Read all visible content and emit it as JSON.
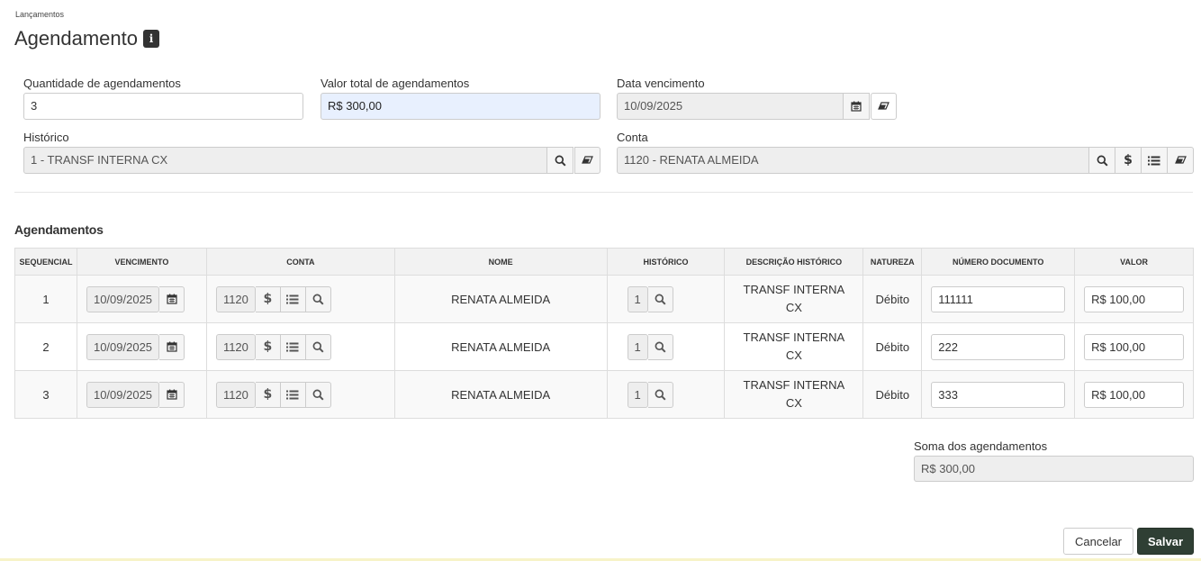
{
  "breadcrumb": "Lançamentos",
  "page_title": "Agendamento",
  "info_glyph": "i",
  "form": {
    "quantidade": {
      "label": "Quantidade de agendamentos",
      "value": "3"
    },
    "valor_total": {
      "label": "Valor total de agendamentos",
      "value": "R$ 300,00"
    },
    "data_vencimento": {
      "label": "Data vencimento",
      "value": "10/09/2025"
    },
    "historico": {
      "label": "Histórico",
      "value": "1 - TRANSF INTERNA CX"
    },
    "conta": {
      "label": "Conta",
      "value": "1120 - RENATA ALMEIDA"
    }
  },
  "section_title": "Agendamentos",
  "table": {
    "headers": [
      "SEQUENCIAL",
      "VENCIMENTO",
      "CONTA",
      "NOME",
      "HISTÓRICO",
      "DESCRIÇÃO HISTÓRICO",
      "NATUREZA",
      "NÚMERO DOCUMENTO",
      "VALOR"
    ],
    "rows": [
      {
        "seq": "1",
        "vencimento": "10/09/2025",
        "conta": "1120",
        "nome": "RENATA ALMEIDA",
        "historico": "1",
        "descricao_l1": "TRANSF INTERNA",
        "descricao_l2": "CX",
        "natureza": "Débito",
        "documento": "111111",
        "valor": "R$ 100,00"
      },
      {
        "seq": "2",
        "vencimento": "10/09/2025",
        "conta": "1120",
        "nome": "RENATA ALMEIDA",
        "historico": "1",
        "descricao_l1": "TRANSF INTERNA",
        "descricao_l2": "CX",
        "natureza": "Débito",
        "documento": "222",
        "valor": "R$ 100,00"
      },
      {
        "seq": "3",
        "vencimento": "10/09/2025",
        "conta": "1120",
        "nome": "RENATA ALMEIDA",
        "historico": "1",
        "descricao_l1": "TRANSF INTERNA",
        "descricao_l2": "CX",
        "natureza": "Débito",
        "documento": "333",
        "valor": "R$ 100,00"
      }
    ]
  },
  "soma": {
    "label": "Soma dos agendamentos",
    "value": "R$ 300,00"
  },
  "buttons": {
    "cancel": "Cancelar",
    "save": "Salvar"
  },
  "icons": [
    "info-icon",
    "calendar-icon",
    "eraser-icon",
    "search-icon",
    "dollar-icon",
    "list-icon"
  ],
  "colors": {
    "save_bg": "#2f3f34",
    "highlight_input": "#e8f0fe",
    "readonly_input": "#eeeeee"
  }
}
